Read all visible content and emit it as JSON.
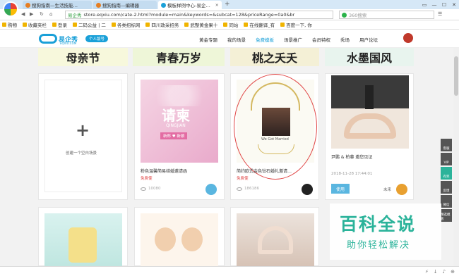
{
  "browser": {
    "tabs": [
      {
        "label": "搜狗指南—生活技能…",
        "active": false
      },
      {
        "label": "搜狗指南—编辑器",
        "active": false
      },
      {
        "label": "模板样例中心-易企…",
        "active": true
      }
    ],
    "new_tab": "+",
    "url_security": "易企秀",
    "url": "store.eqxiu.com/cate-2.html?module=main&keywords=&subcat=128&priceRange=0a0&br",
    "search_placeholder": "360搜索",
    "win_controls": [
      "▭",
      "—",
      "☐",
      "✕"
    ]
  },
  "bookmarks": [
    "购物",
    "收藏夹栏",
    "登录",
    "二码公益 | 二",
    "各类招标网",
    "四川政采招务",
    "武整黄金果十",
    "同站",
    "在线翻译_有",
    "百度一下, 你"
  ],
  "site": {
    "logo_text": "易企秀",
    "logo_sub": "EQXIU.COM",
    "member_pill": "个人版号",
    "nav": [
      {
        "label": "黄金专题",
        "active": false
      },
      {
        "label": "我的场景",
        "active": false
      },
      {
        "label": "免费模板",
        "active": true
      },
      {
        "label": "场景推广",
        "active": false
      },
      {
        "label": "会员特权",
        "active": false
      },
      {
        "label": "秀场",
        "active": false
      },
      {
        "label": "用户论坛",
        "active": false
      }
    ]
  },
  "banners": [
    "母亲节",
    "青春万岁",
    "桃之夭夭",
    "水墨国风"
  ],
  "cards": {
    "create": {
      "label": "创建一个空白场景",
      "plus": "+"
    },
    "c2": {
      "thumb_title": "请柬",
      "thumb_sub": "QINGJIAN",
      "thumb_names": "新郎 ♥ 新娘",
      "title": "粉色温馨简易结婚邀请函",
      "tag": "免费使",
      "views": "10080"
    },
    "c3": {
      "thumb_text": "We Got Married",
      "title": "简约欧式金色钻石婚礼邀请…",
      "tag": "免费使",
      "views": "186186"
    },
    "c4": {
      "title": "尹鹏 & 柏蓉 邀您见证",
      "date": "2018-11-28 17:44:01",
      "use_button": "使用",
      "author": "未来"
    }
  },
  "side_tools": [
    "客服",
    "VIP",
    "有奖",
    "反馈",
    "微信",
    "精选模板"
  ],
  "watermark": {
    "big": "百科全说",
    "small": "助你轻松解决"
  },
  "colors": {
    "accent": "#1aa0d8",
    "green": "#2bb39a",
    "red_tag": "#e04545"
  }
}
